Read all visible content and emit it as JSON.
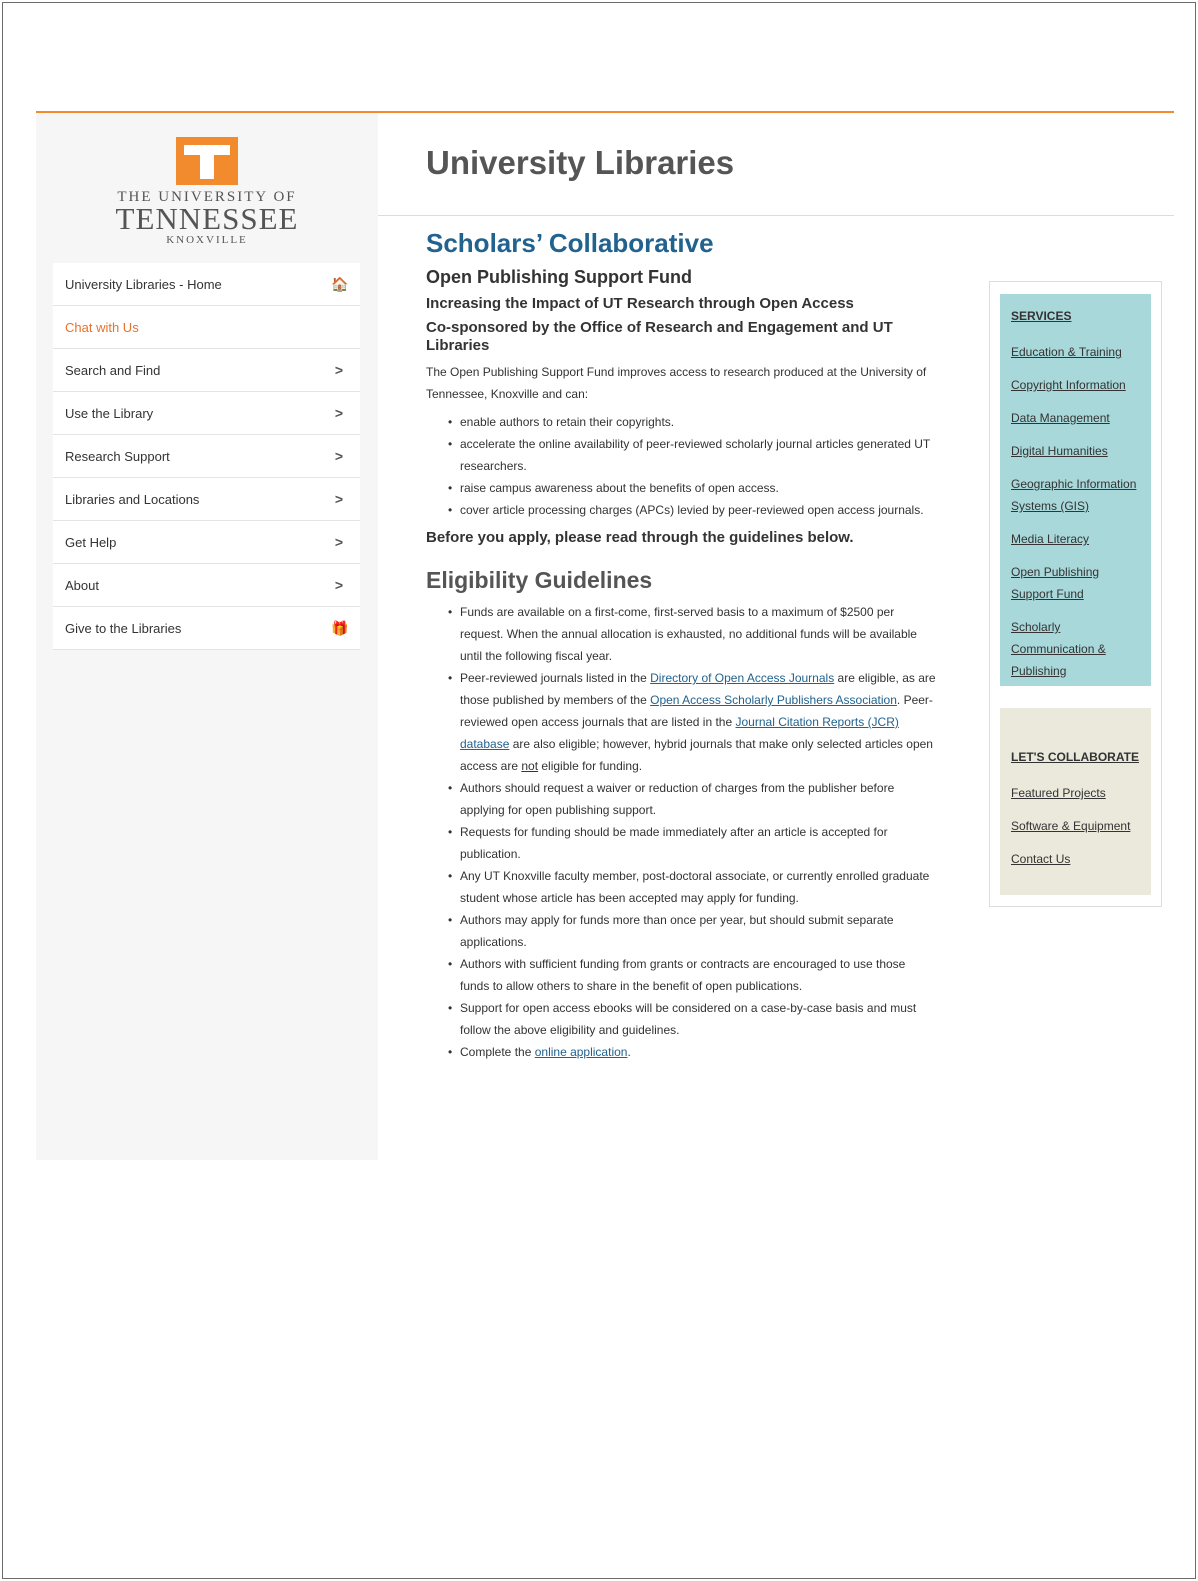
{
  "sidebar": {
    "logo": {
      "line1": "THE UNIVERSITY OF",
      "line2": "TENNESSEE",
      "line3": "KNOXVILLE"
    },
    "items": [
      {
        "label": "University Libraries - Home",
        "icon": "home-icon",
        "glyph": "🏠"
      },
      {
        "label": "Chat with Us",
        "icon": "",
        "glyph": ""
      },
      {
        "label": "Search and Find",
        "icon": "chevron-right-icon",
        "glyph": ">"
      },
      {
        "label": "Use the Library",
        "icon": "chevron-right-icon",
        "glyph": ">"
      },
      {
        "label": "Research Support",
        "icon": "chevron-right-icon",
        "glyph": ">"
      },
      {
        "label": "Libraries and Locations",
        "icon": "chevron-right-icon",
        "glyph": ">"
      },
      {
        "label": "Get Help",
        "icon": "chevron-right-icon",
        "glyph": ">"
      },
      {
        "label": "About",
        "icon": "chevron-right-icon",
        "glyph": ">"
      },
      {
        "label": "Give to the Libraries",
        "icon": "gift-icon",
        "glyph": "🎁"
      }
    ]
  },
  "header": {
    "title": "University Libraries"
  },
  "main": {
    "heading": "Scholars’ Collaborative",
    "subheading": "Open Publishing Support Fund",
    "tagline": "Increasing the Impact of UT Research through Open Access",
    "cosponsor": "Co-sponsored by the Office of Research and Engagement and UT Libraries",
    "intro": "The Open Publishing Support Fund improves access to research produced at the University of Tennessee, Knoxville and can:",
    "benefits": [
      "enable authors to retain their copyrights.",
      "accelerate the online availability of peer-reviewed scholarly journal articles generated UT researchers.",
      "raise campus awareness about the benefits of open access.",
      "cover article processing charges (APCs) levied by peer-reviewed open access journals."
    ],
    "before_apply": "Before you apply, please read through the guidelines below.",
    "eligibility_heading": "Eligibility Guidelines",
    "guideline1": "Funds are available on a first-come, first-served basis to a maximum of $2500 per request.  When the annual allocation is exhausted, no additional funds will be available until the following fiscal year.",
    "guideline2": {
      "t1": "Peer-reviewed journals listed in the ",
      "l1": "Directory of Open Access Journals",
      "t2": " are eligible, as are those published by members of the ",
      "l2": "Open Access Scholarly Publishers Association",
      "t3": ". Peer-reviewed open access journals that are listed in the ",
      "l3": "Journal Citation Reports (JCR) database",
      "t4": " are also eligible; however, hybrid journals that make only selected articles open access are ",
      "u1": "not",
      "t5": " eligible for funding."
    },
    "guidelines_rest": [
      "Authors should request a waiver or reduction of charges from the publisher before applying for open publishing support.",
      "Requests for funding should be made immediately after an article is accepted for publication.",
      "Any UT Knoxville faculty member, post-doctoral associate, or currently enrolled graduate student whose article has been accepted may apply for funding.",
      "Authors may apply for funds more than once per year, but should submit separate applications.",
      "Authors with sufficient funding from grants or contracts are encouraged to use those funds to allow others to share in the benefit of open publications.",
      "Support for open access ebooks will be considered on a case-by-case basis and must follow the above eligibility and guidelines."
    ],
    "guideline_last": {
      "t1": "Complete the ",
      "l1": "online application",
      "t2": "."
    }
  },
  "right": {
    "services_heading": "SERVICES",
    "services": [
      "Education & Training",
      "Copyright Information",
      "Data Management",
      "Digital Humanities",
      "Geographic Information Systems (GIS)",
      "Media Literacy",
      "Open Publishing Support Fund",
      "Scholarly Communication & Publishing"
    ],
    "collab_heading": "LET'S COLLABORATE",
    "collab": [
      "Featured Projects",
      "Software & Equipment",
      "Contact Us"
    ]
  },
  "colors": {
    "accent": "#f28a2e",
    "heading_blue": "#22628e",
    "services_bg": "#a9d8da",
    "collab_bg": "#ebe8dc"
  }
}
